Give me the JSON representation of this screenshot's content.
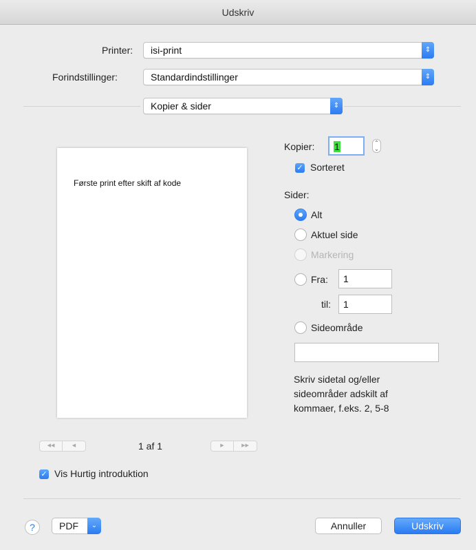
{
  "window": {
    "title": "Udskriv"
  },
  "printer": {
    "label": "Printer:",
    "value": "isi-print"
  },
  "presets": {
    "label": "Forindstillinger:",
    "value": "Standardindstillinger"
  },
  "section": {
    "value": "Kopier & sider"
  },
  "preview": {
    "text": "Første print efter skift af kode",
    "page_info": "1 af 1"
  },
  "copies": {
    "label": "Kopier:",
    "value": "1",
    "collated_label": "Sorteret",
    "collated": true
  },
  "pages": {
    "label": "Sider:",
    "all_label": "Alt",
    "current_label": "Aktuel side",
    "selection_label": "Markering",
    "from_label": "Fra:",
    "from_value": "1",
    "to_label": "til:",
    "to_value": "1",
    "range_label": "Sideområde",
    "range_value": "",
    "hint": "Skriv sidetal og/eller sideområder adskilt af kommaer, f.eks. 2, 5-8",
    "selected": "Alt"
  },
  "quick_intro": {
    "label": "Vis Hurtig introduktion",
    "checked": true
  },
  "footer": {
    "help": "?",
    "pdf_label": "PDF",
    "cancel_label": "Annuller",
    "print_label": "Udskriv"
  },
  "colors": {
    "accent": "#2b7bf3",
    "background": "#ececec"
  },
  "icons": {
    "popup_arrows": "updown-chevrons-icon",
    "nav_first": "first-page-icon",
    "nav_prev": "previous-page-icon",
    "nav_next": "next-page-icon",
    "nav_last": "last-page-icon",
    "checkmark": "checkmark-icon",
    "stepper": "stepper-icon",
    "pdf_menu": "chevron-down-icon"
  }
}
